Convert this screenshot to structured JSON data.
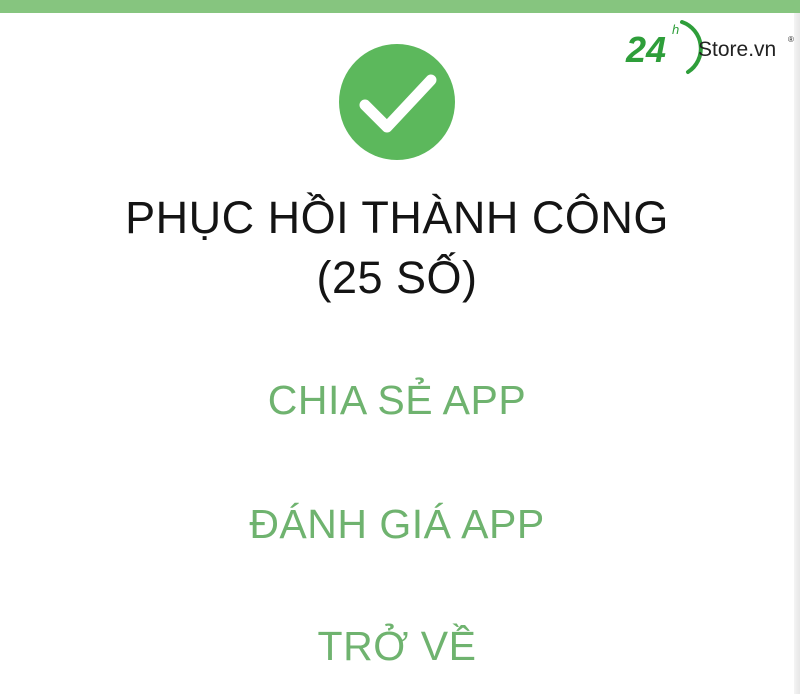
{
  "colors": {
    "accent": "#5cb85c",
    "accent_text": "#6fb36f",
    "top_bar": "#86c57f",
    "logo_green": "#2e9e3a",
    "title": "#141414"
  },
  "watermark": {
    "number": "24",
    "superscript": "h",
    "brand": "Store.vn",
    "registered": "®"
  },
  "status": {
    "icon": "check-icon",
    "title_line1": "PHỤC HỒI THÀNH CÔNG",
    "title_line2": "(25 SỐ)"
  },
  "actions": {
    "share": "CHIA SẺ APP",
    "rate": "ĐÁNH GIÁ APP",
    "back": "TRỞ VỀ"
  }
}
